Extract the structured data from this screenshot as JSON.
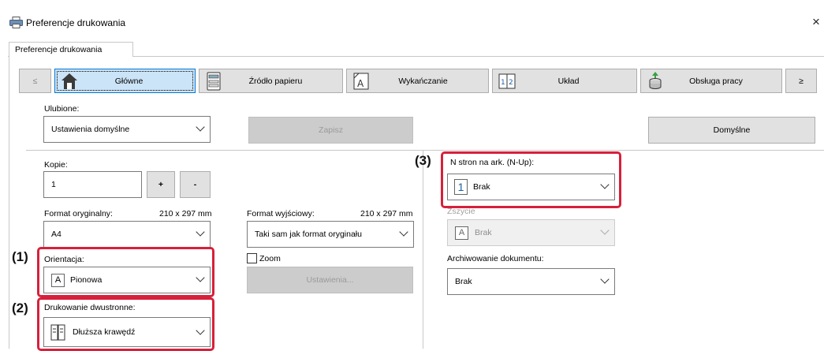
{
  "window": {
    "title": "Preferencje drukowania",
    "close_glyph": "×"
  },
  "tabs": [
    {
      "label": "Preferencje drukowania"
    }
  ],
  "nav": {
    "prev": "≤",
    "next": "≥",
    "items": [
      {
        "label": "Główne",
        "icon": "home-icon",
        "active": true
      },
      {
        "label": "Źródło papieru",
        "icon": "paper-tray-icon",
        "active": false
      },
      {
        "label": "Wykańczanie",
        "icon": "finishing-icon",
        "active": false
      },
      {
        "label": "Układ",
        "icon": "layout-icon",
        "active": false
      },
      {
        "label": "Obsługa pracy",
        "icon": "job-handling-icon",
        "active": false
      }
    ]
  },
  "favorites": {
    "label": "Ulubione:",
    "value": "Ustawienia domyślne",
    "save": "Zapisz",
    "default": "Domyślne"
  },
  "copies": {
    "label": "Kopie:",
    "value": "1",
    "plus": "+",
    "minus": "-"
  },
  "original_size": {
    "label": "Format oryginalny:",
    "dims": "210 x 297 mm",
    "value": "A4"
  },
  "output_size": {
    "label": "Format wyjściowy:",
    "dims": "210 x 297 mm",
    "value": "Taki sam jak format oryginału"
  },
  "orientation": {
    "label": "Orientacja:",
    "value": "Pionowa",
    "icon_char": "A"
  },
  "zoom": {
    "label": "Zoom",
    "checked": false,
    "settings": "Ustawienia..."
  },
  "duplex": {
    "label": "Drukowanie dwustronne:",
    "value": "Dłuższa krawędź"
  },
  "nup": {
    "label": "N stron na ark. (N-Up):",
    "value": "Brak",
    "icon_char": "1"
  },
  "hidden_field": {
    "label": "Zszycie",
    "value": "Brak",
    "icon_char": "A"
  },
  "archive": {
    "label": "Archiwowanie dokumentu:",
    "value": "Brak"
  },
  "callouts": [
    "(1)",
    "(2)",
    "(3)"
  ],
  "colors": {
    "highlight_red": "#d7203b",
    "active_tab": "#cce4f7",
    "accent_blue": "#0078d7"
  }
}
